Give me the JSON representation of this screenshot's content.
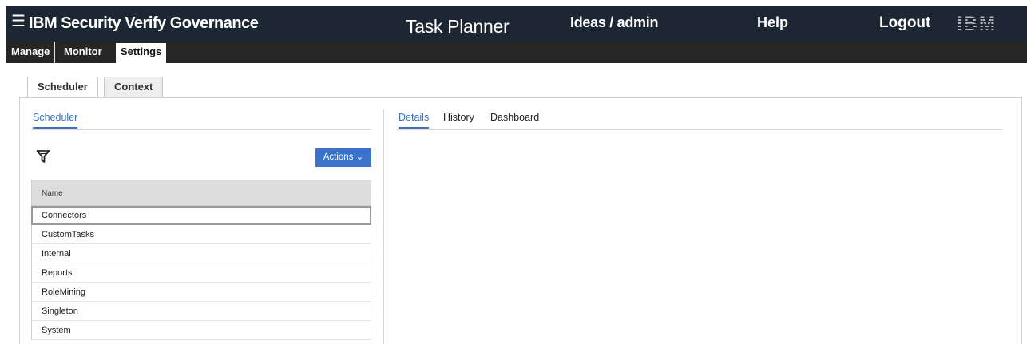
{
  "header": {
    "menu_icon": "hamburger-menu-icon",
    "product": "IBM Security Verify Governance",
    "module": "Task Planner",
    "user": "Ideas / admin",
    "help": "Help",
    "logout": "Logout",
    "logo": "IBM"
  },
  "nav": {
    "tabs": [
      {
        "label": "Manage"
      },
      {
        "label": "Monitor"
      },
      {
        "label": "Settings",
        "active": true
      }
    ]
  },
  "outer_tabs": [
    {
      "label": "Scheduler",
      "active": true
    },
    {
      "label": "Context"
    }
  ],
  "left": {
    "title": "Scheduler",
    "filter_icon": "filter-icon",
    "actions_label": "Actions ⌄",
    "column_header": "Name",
    "rows": [
      "Connectors",
      "CustomTasks",
      "Internal",
      "Reports",
      "RoleMining",
      "Singleton",
      "System"
    ],
    "selected_row": "Connectors"
  },
  "right": {
    "tabs": [
      {
        "label": "Details",
        "active": true
      },
      {
        "label": "History"
      },
      {
        "label": "Dashboard"
      }
    ]
  },
  "colors": {
    "header_bg": "#1d2733",
    "nav_bg": "#262626",
    "accent": "#3b73c4",
    "button_bg": "#3a73c9"
  }
}
